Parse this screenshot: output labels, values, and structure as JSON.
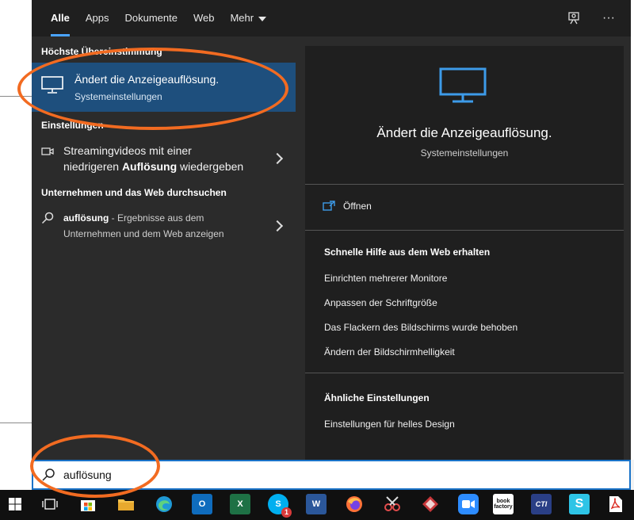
{
  "tabs": {
    "items": [
      {
        "label": "Alle"
      },
      {
        "label": "Apps"
      },
      {
        "label": "Dokumente"
      },
      {
        "label": "Web"
      },
      {
        "label": "Mehr"
      }
    ],
    "feedback_icon": "feedback-icon",
    "more_icon": "ellipsis-icon",
    "more_glyph": "···"
  },
  "left": {
    "best_match_heading": "Höchste Übereinstimmung",
    "best_match": {
      "title": "Ändert die Anzeigeauflösung.",
      "subtitle": "Systemeinstellungen",
      "icon": "monitor-icon"
    },
    "settings_heading": "Einstellungen",
    "streaming": {
      "line1": "Streamingvideos mit einer",
      "line2_pre": "niedrigeren ",
      "line2_bold": "Auflösung",
      "line2_post": " wiedergeben",
      "icon": "video-icon"
    },
    "web_heading": "Unternehmen und das Web durchsuchen",
    "web": {
      "query": "auflösung",
      "suffix": " - Ergebnisse aus dem",
      "line2": "Unternehmen und dem Web anzeigen",
      "icon": "search-icon"
    }
  },
  "right": {
    "title": "Ändert die Anzeigeauflösung.",
    "subtitle": "Systemeinstellungen",
    "open_label": "Öffnen",
    "quick_help_heading": "Schnelle Hilfe aus dem Web erhalten",
    "quick_help_links": [
      "Einrichten mehrerer Monitore",
      "Anpassen der Schriftgröße",
      "Das Flackern des Bildschirms wurde behoben",
      "Ändern der Bildschirmhelligkeit"
    ],
    "related_heading": "Ähnliche Einstellungen",
    "related_links": [
      "Einstellungen für helles Design"
    ]
  },
  "search": {
    "value": "auflösung"
  },
  "taskbar": {
    "skype_badge": "1",
    "outlook_letter": "O",
    "excel_letter": "X",
    "word_letter": "W",
    "skype_letter": "S",
    "bookfactory_label": "book factory",
    "cti_label": "CTI",
    "s_app_letter": "S",
    "colors": {
      "edge": "#1f9ad6",
      "outlook": "#0f6cbd",
      "excel": "#1e7145",
      "word": "#2b579a",
      "skype": "#00aff0",
      "firefox": "#ff7139",
      "zoom": "#2d8cff",
      "accent": "#1e4f7d",
      "annotation": "#f26b21"
    }
  }
}
